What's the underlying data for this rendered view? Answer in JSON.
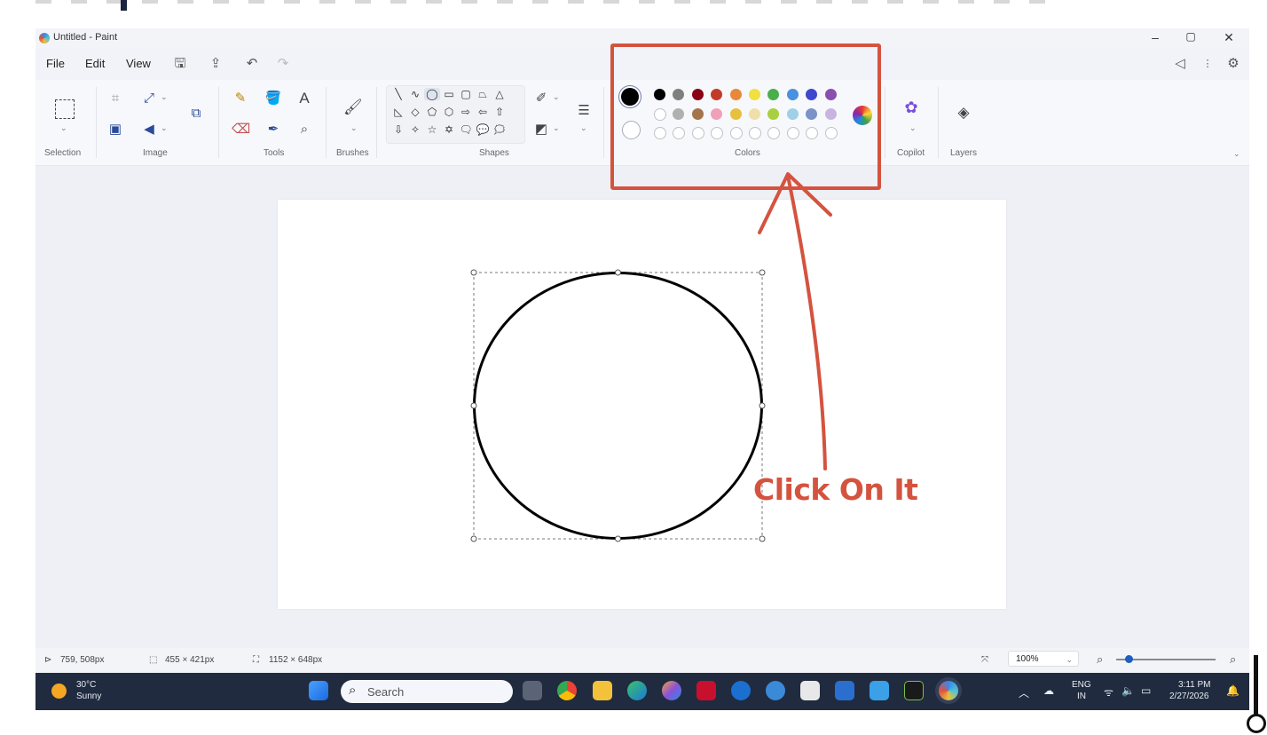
{
  "window": {
    "title": "Untitled - Paint",
    "controls": [
      "–",
      "▢",
      "✕"
    ]
  },
  "menu": {
    "file": "File",
    "edit": "Edit",
    "view": "View"
  },
  "ribbon": {
    "groups": {
      "selection": "Selection",
      "image": "Image",
      "tools": "Tools",
      "brushes": "Brushes",
      "shapes": "Shapes",
      "colors": "Colors",
      "copilot": "Copilot",
      "layers": "Layers"
    },
    "palette_row1": [
      "#000000",
      "#7f7f7f",
      "#880015",
      "#c43a2a",
      "#e8883a",
      "#f0e040",
      "#4aae4a",
      "#4a90e2",
      "#3f48cc",
      "#8a4fb0"
    ],
    "palette_row2": [
      "#ffffff",
      "#b0b0b0",
      "#a5754a",
      "#f0a0b8",
      "#e8c040",
      "#eee0a8",
      "#a8d040",
      "#9ed0e8",
      "#7a92c8",
      "#c8b4e0"
    ],
    "primary_color": "#000000",
    "secondary_color": "#ffffff"
  },
  "status": {
    "cursor_pos": "759, 508px",
    "selection_size": "455 × 421px",
    "canvas_size": "1152 × 648px",
    "zoom": "100%"
  },
  "taskbar": {
    "temperature": "30°C",
    "weather": "Sunny",
    "search_placeholder": "Search",
    "lang_top": "ENG",
    "lang_bottom": "IN",
    "time": "3:11 PM",
    "date": "2/27/2026"
  },
  "annotation": {
    "text": "Click On It",
    "color": "#d4533f"
  }
}
